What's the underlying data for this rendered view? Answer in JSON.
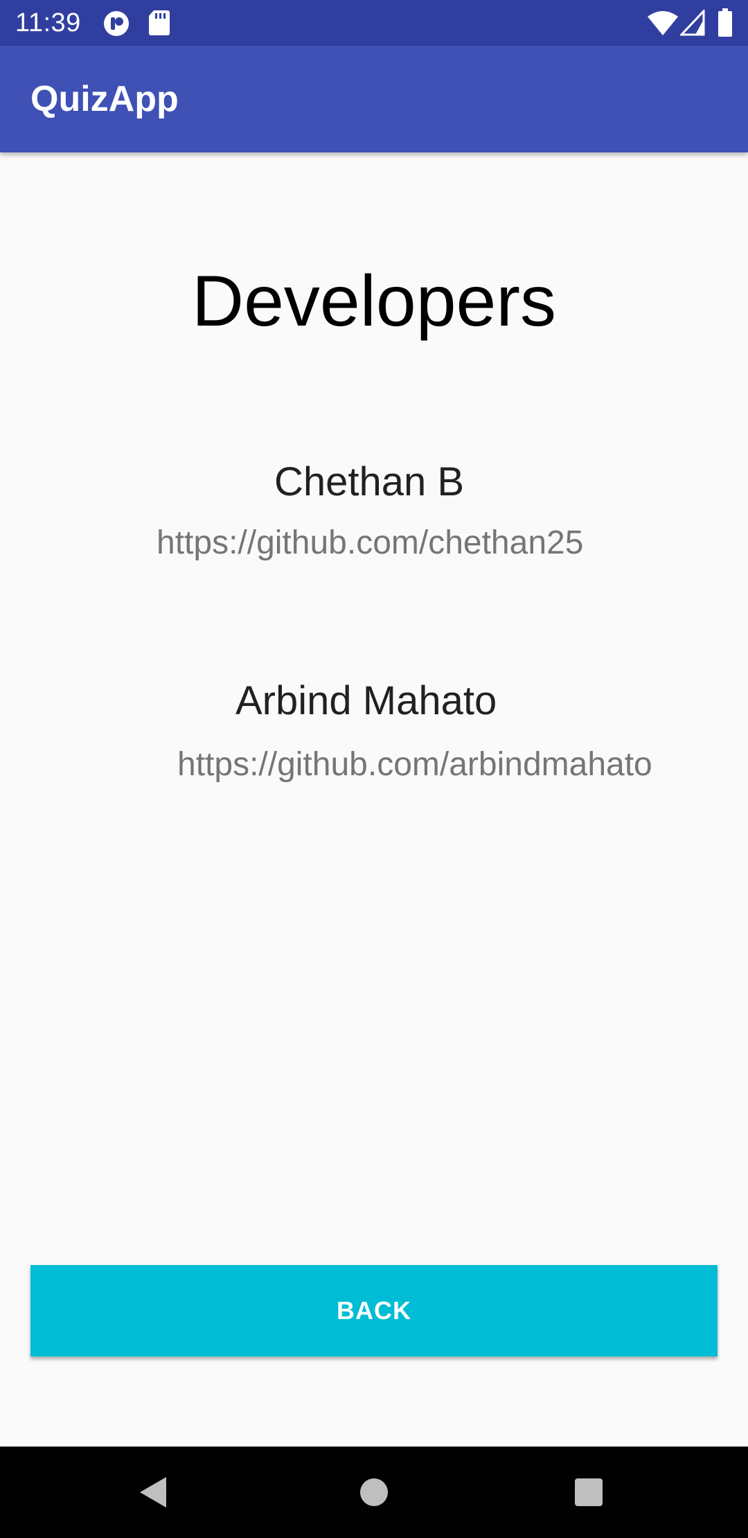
{
  "status_bar": {
    "time": "11:39",
    "left_icons": [
      "app-notification-icon",
      "sd-card-icon"
    ],
    "right_icons": [
      "wifi-icon",
      "cell-signal-icon",
      "battery-icon"
    ],
    "color": "#303f9f"
  },
  "app_bar": {
    "title": "QuizApp",
    "color": "#3f51b5"
  },
  "main": {
    "heading": "Developers",
    "developers": [
      {
        "name": "Chethan B",
        "link": "https://github.com/chethan25"
      },
      {
        "name": "Arbind Mahato",
        "link": "https://github.com/arbindmahato"
      }
    ]
  },
  "back_button": {
    "label": "BACK",
    "color": "#00bcd4"
  },
  "nav_bar": {
    "buttons": [
      "back-triangle-icon",
      "home-circle-icon",
      "recents-square-icon"
    ]
  }
}
